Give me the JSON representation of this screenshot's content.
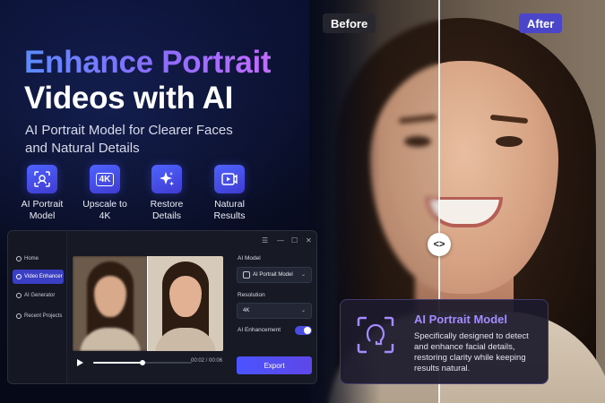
{
  "headline": {
    "line1": "Enhance Portrait",
    "line2": "Videos with AI",
    "subtitle": "AI Portrait Model for Clearer Faces and Natural Details"
  },
  "features": [
    {
      "icon": "face-scan-icon",
      "label": "AI Portrait Model"
    },
    {
      "icon": "4k-icon",
      "label": "Upscale to 4K",
      "icon_text": "4K"
    },
    {
      "icon": "sparkle-icon",
      "label": "Restore Details"
    },
    {
      "icon": "video-play-icon",
      "label": "Natural Results"
    }
  ],
  "comparison": {
    "before_label": "Before",
    "after_label": "After",
    "handle_glyph": "<>"
  },
  "app": {
    "sidebar": [
      {
        "label": "Home",
        "icon": "home-icon",
        "active": false
      },
      {
        "label": "Video Enhancer",
        "icon": "video-enhancer-icon",
        "active": true
      },
      {
        "label": "AI Generator",
        "icon": "ai-generator-icon",
        "active": false
      },
      {
        "label": "Recent Projects",
        "icon": "clock-icon",
        "active": false
      }
    ],
    "window_controls": [
      "menu-icon",
      "minimize-icon",
      "maximize-icon",
      "close-icon"
    ],
    "player": {
      "time": "00:02 / 00:06",
      "progress": 0.5
    },
    "panel": {
      "model_label": "AI Model",
      "model_value": "AI Portrait Model",
      "resolution_label": "Resolution",
      "resolution_value": "4K",
      "enhancement_label": "AI Enhancement",
      "enhancement_on": true,
      "export_label": "Export"
    }
  },
  "card": {
    "title": "AI Portrait Model",
    "description": "Specifically designed to detect and enhance facial details, restoring clarity while keeping results natural."
  },
  "colors": {
    "accent": "#4b46c9",
    "headline_gradient": [
      "#5b8bff",
      "#c36bff"
    ],
    "card_title": "#a48cff"
  }
}
